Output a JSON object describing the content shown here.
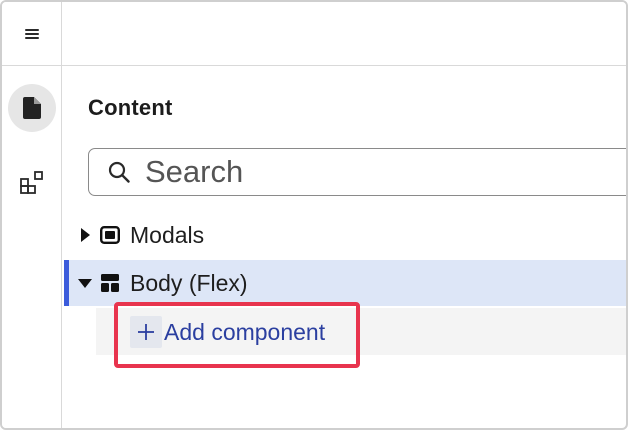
{
  "sidebar": {
    "menu_icon": "hamburger-menu-icon",
    "items": [
      {
        "icon": "page-icon",
        "active": true
      },
      {
        "icon": "components-icon",
        "active": false
      }
    ]
  },
  "panel": {
    "title": "Content",
    "search": {
      "placeholder": "Search",
      "value": ""
    },
    "tree": [
      {
        "label": "Modals",
        "expanded": false,
        "icon": "modal-icon",
        "selected": false
      },
      {
        "label": "Body (Flex)",
        "expanded": true,
        "icon": "flex-layout-icon",
        "selected": true
      }
    ],
    "add_component": {
      "symbol": "+",
      "label": "Add component"
    }
  },
  "colors": {
    "selected_row_bg": "#dde6f7",
    "selected_accent": "#3b5bdb",
    "highlight_outline": "#e8344e",
    "add_link": "#2b3fa0"
  }
}
